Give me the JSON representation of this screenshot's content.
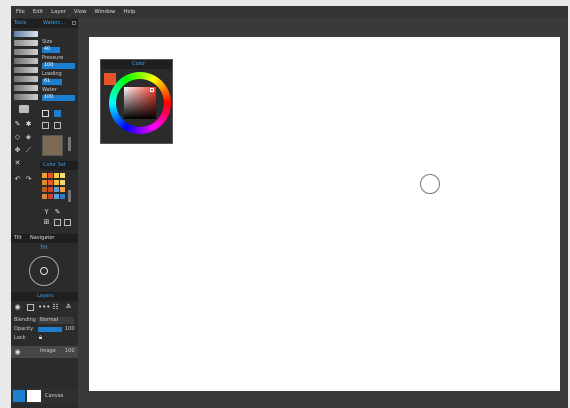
{
  "menu": [
    "File",
    "Edit",
    "Layer",
    "View",
    "Window",
    "Help"
  ],
  "tools_panel": {
    "tab_tools": "Tools",
    "tab_watercolor": "Waterc..."
  },
  "brush_settings": [
    {
      "label": "Size",
      "value": "40"
    },
    {
      "label": "Pressure",
      "value": "100"
    },
    {
      "label": "Loading",
      "value": "61"
    },
    {
      "label": "Water",
      "value": "100"
    }
  ],
  "color_set": {
    "title": "Color Set"
  },
  "color_panel": {
    "title": "Color",
    "current_color": "#e8552b"
  },
  "tilt": {
    "tab_tilt": "Tilt",
    "tab_navigator": "Navigator",
    "title": "Tilt"
  },
  "layers": {
    "title": "Layers",
    "blending_label": "Blending",
    "blending_value": "Normal",
    "opacity_label": "Opacity",
    "opacity_value": "100",
    "lock_label": "Lock",
    "layer_name": "Image",
    "layer_opacity": "100",
    "canvas_label": "Canvas"
  },
  "colors": {
    "accent": "#1c7fcf",
    "canvas": "#ffffff",
    "workspace": "#3a3a3a"
  },
  "swatches": [
    "#f0a030",
    "#e8552b",
    "#f6d040",
    "#f7e070",
    "#e08a20",
    "#e45a28",
    "#f4c23c",
    "#f6d86a",
    "#c06020",
    "#d04820",
    "#5b9ad6",
    "#f2a440",
    "#d88838",
    "#c84528",
    "#5aa0e0",
    "#3478c4"
  ]
}
